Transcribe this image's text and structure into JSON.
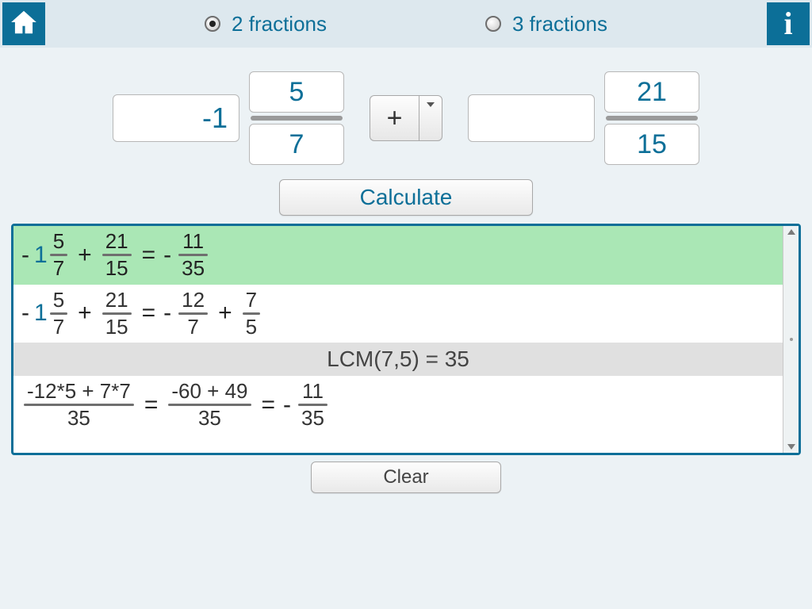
{
  "modes": {
    "two": "2 fractions",
    "three": "3 fractions"
  },
  "inputs": {
    "a_whole": "-1",
    "a_num": "5",
    "a_den": "7",
    "op": "+",
    "b_whole": "",
    "b_num": "21",
    "b_den": "15"
  },
  "buttons": {
    "calculate": "Calculate",
    "clear": "Clear"
  },
  "solution": {
    "lcm_text": "LCM(7,5) = 35",
    "row1": {
      "minus1": "-",
      "one": "1",
      "f1n": "5",
      "f1d": "7",
      "plus": "+",
      "f2n": "21",
      "f2d": "15",
      "eq": "=",
      "minus2": "-",
      "rn": "11",
      "rd": "35"
    },
    "row2": {
      "minus1": "-",
      "one": "1",
      "f1n": "5",
      "f1d": "7",
      "plus": "+",
      "f2n": "21",
      "f2d": "15",
      "eq": "=",
      "minus2": "-",
      "g1n": "12",
      "g1d": "7",
      "plus2": "+",
      "g2n": "7",
      "g2d": "5"
    },
    "row3": {
      "f1n": "-12*5 + 7*7",
      "f1d": "35",
      "eq1": "=",
      "f2n": "-60 + 49",
      "f2d": "35",
      "eq2": "=",
      "minus": "-",
      "rn": "11",
      "rd": "35"
    }
  }
}
